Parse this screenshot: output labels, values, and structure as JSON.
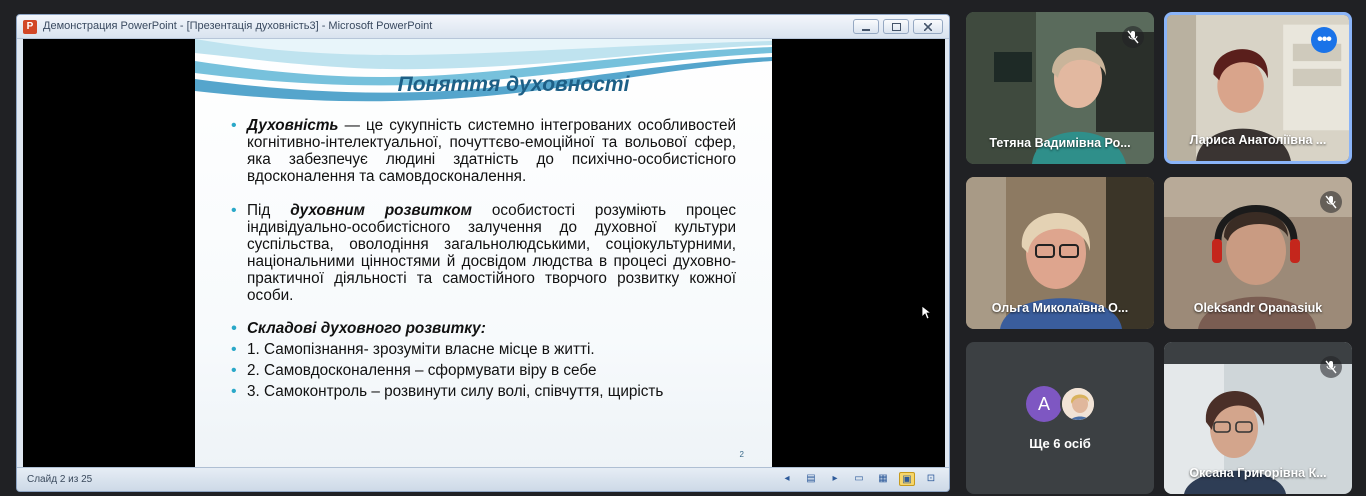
{
  "powerpoint": {
    "window_title": "Демонстрация PowerPoint - [Презентація духовність3] - Microsoft PowerPoint",
    "logo_letter": "P",
    "status": "Слайд 2 из 25",
    "slide_number": "2"
  },
  "slide": {
    "title": "Поняття духовності",
    "b1_term": "Духовність",
    "b1_text": " — це сукупність системно інтегрованих особливостей когнітивно-інтелектуальної, почуттєво-емоційної та вольової сфер, яка забезпечує людині здатність до психічно-особистісного вдосконалення та самовдосконалення.",
    "b2_pre": "Під ",
    "b2_term": "духовним розвитком",
    "b2_text": " особистості розуміють процес індивідуально-особистісного залучення до духовної культури суспільства, оволодіння загальнолюдськими, соціокультурними, національними цінностями й досвідом людства в процесі духовно-практичної діяльності та самостійного творчого розвитку кожної особи.",
    "b3_heading": "Складові духовного  розвитку:",
    "items": [
      "1. Самопізнання-  зрозуміти власне місце в житті.",
      "2. Самовдосконалення  – сформувати віру в себе",
      "3. Самоконтроль  – розвинути силу волі, співчуття, щирість"
    ]
  },
  "participants": [
    {
      "name": "Тетяна Вадимівна Ро..."
    },
    {
      "name": "Лариса Анатоліївна ..."
    },
    {
      "name": "Ольга Миколаївна О..."
    },
    {
      "name": "Oleksandr Opanasiuk"
    },
    {
      "name": "Оксана Григорівна К..."
    }
  ],
  "more": {
    "avatar_letter": "A",
    "label": "Ще 6 осіб"
  },
  "colors": {
    "meet_bg": "#202124",
    "tile_bg": "#3c4043",
    "slide_title": "#1d5f86",
    "accent_blue": "#1a73e8",
    "avatar_purple": "#7e57c2"
  }
}
